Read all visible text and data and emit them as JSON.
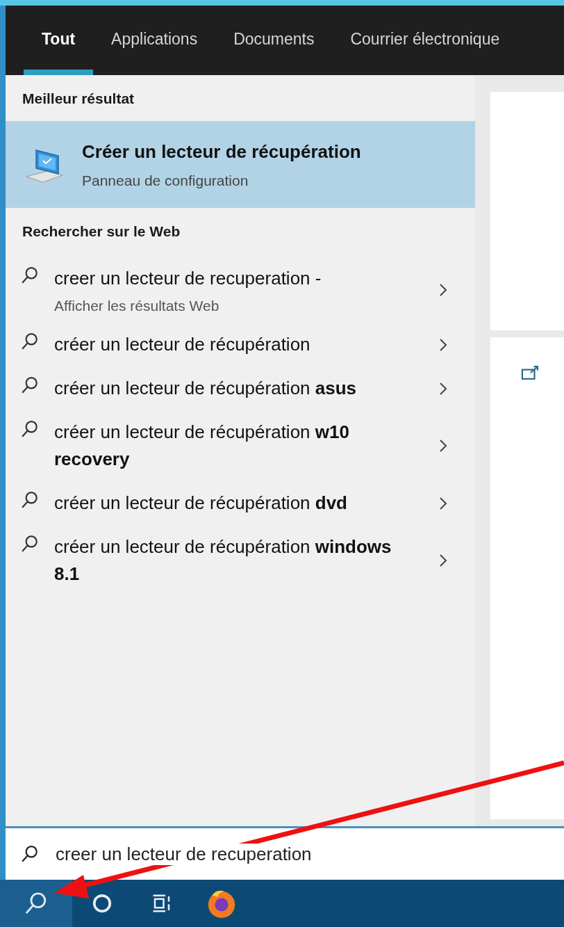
{
  "tabs": [
    {
      "label": "Tout",
      "selected": true
    },
    {
      "label": "Applications",
      "selected": false
    },
    {
      "label": "Documents",
      "selected": false
    },
    {
      "label": "Courrier électronique",
      "selected": false
    }
  ],
  "best_match": {
    "heading": "Meilleur résultat",
    "title": "Créer un lecteur de récupération",
    "subtitle": "Panneau de configuration",
    "selected": true
  },
  "web": {
    "heading": "Rechercher sur le Web",
    "items": [
      {
        "text": "creer un lecteur de recuperation -",
        "subtitle": "Afficher les résultats Web"
      },
      {
        "text": "créer un lecteur de récupération"
      },
      {
        "text": "créer un lecteur de récupération **asus**"
      },
      {
        "text": "créer un lecteur de récupération **w10 recovery**"
      },
      {
        "text": "créer un lecteur de récupération **dvd**"
      },
      {
        "text": "créer un lecteur de récupération **windows 8.1**"
      }
    ]
  },
  "search": {
    "value": "creer un lecteur de recuperation"
  },
  "taskbar": {
    "items": [
      {
        "kind": "search",
        "selected": true
      },
      {
        "kind": "cortana",
        "selected": false
      },
      {
        "kind": "task-view",
        "selected": false
      },
      {
        "kind": "browser",
        "selected": false
      }
    ]
  }
}
